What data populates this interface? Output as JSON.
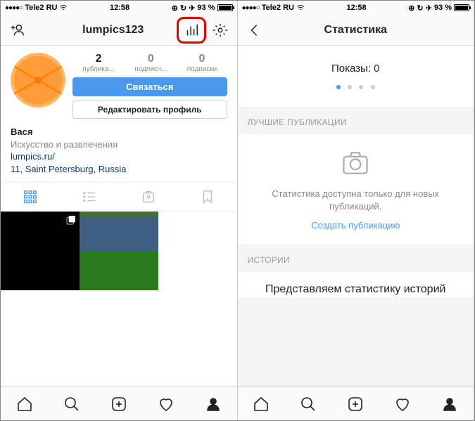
{
  "status": {
    "carrier": "Tele2 RU",
    "time": "12:58",
    "battery_pct": "93 %"
  },
  "left": {
    "username": "lumpics123",
    "stats": {
      "posts_num": "2",
      "posts_lbl": "публика...",
      "followers_num": "0",
      "followers_lbl": "подписч...",
      "following_num": "0",
      "following_lbl": "подписки"
    },
    "contact_btn": "Связаться",
    "edit_btn": "Редактировать профиль",
    "bio": {
      "name": "Вася",
      "category": "Искусство и развлечения",
      "link": "lumpics.ru/",
      "location": "11, Saint Petersburg, Russia"
    }
  },
  "right": {
    "title": "Статистика",
    "impressions_lbl": "Показы: 0",
    "section1": "ЛУЧШИЕ ПУБЛИКАЦИИ",
    "empty_text": "Статистика доступна только для новых публикаций.",
    "create_link": "Создать публикацию",
    "section2": "ИСТОРИИ",
    "stories_title": "Представляем статистику историй"
  }
}
